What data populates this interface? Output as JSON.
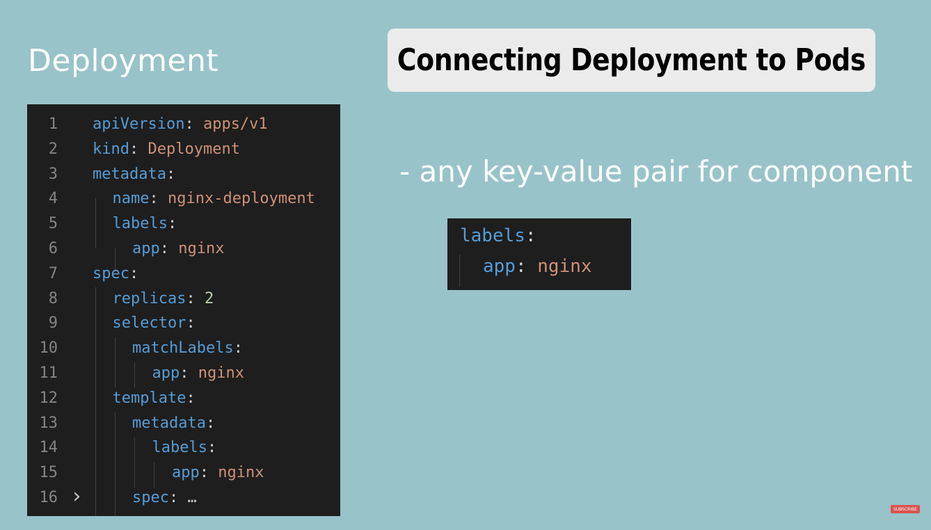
{
  "slide": {
    "section_title": "Deployment",
    "heading": "Connecting Deployment to Pods",
    "bullet": "- any key-value pair for component"
  },
  "editor": {
    "lines": [
      {
        "num": "1",
        "key": "apiVersion",
        "colon": ":",
        "value": "apps/v1",
        "type": "str"
      },
      {
        "num": "2",
        "key": "kind",
        "colon": ":",
        "value": "Deployment",
        "type": "str"
      },
      {
        "num": "3",
        "key": "metadata",
        "colon": ":",
        "value": "",
        "type": "str"
      },
      {
        "num": "4",
        "key": "name",
        "colon": ":",
        "value": "nginx-deployment",
        "type": "str"
      },
      {
        "num": "5",
        "key": "labels",
        "colon": ":",
        "value": "",
        "type": "str"
      },
      {
        "num": "6",
        "key": "app",
        "colon": ":",
        "value": "nginx",
        "type": "str"
      },
      {
        "num": "7",
        "key": "spec",
        "colon": ":",
        "value": "",
        "type": "str"
      },
      {
        "num": "8",
        "key": "replicas",
        "colon": ":",
        "value": "2",
        "type": "num"
      },
      {
        "num": "9",
        "key": "selector",
        "colon": ":",
        "value": "",
        "type": "str"
      },
      {
        "num": "10",
        "key": "matchLabels",
        "colon": ":",
        "value": "",
        "type": "str"
      },
      {
        "num": "11",
        "key": "app",
        "colon": ":",
        "value": "nginx",
        "type": "str"
      },
      {
        "num": "12",
        "key": "template",
        "colon": ":",
        "value": "",
        "type": "str"
      },
      {
        "num": "13",
        "key": "metadata",
        "colon": ":",
        "value": "",
        "type": "str"
      },
      {
        "num": "14",
        "key": "labels",
        "colon": ":",
        "value": "",
        "type": "str"
      },
      {
        "num": "15",
        "key": "app",
        "colon": ":",
        "value": "nginx",
        "type": "str"
      },
      {
        "num": "16",
        "key": "spec",
        "colon": ":",
        "value": "…",
        "type": "dots"
      }
    ],
    "fold_icon": "chevron-right-icon"
  },
  "snippet": {
    "line1_key": "labels",
    "line1_colon": ":",
    "line2_key": "app",
    "line2_colon": ":",
    "line2_value": "nginx"
  },
  "badge": {
    "label": "SUBSCRIBE"
  },
  "colors": {
    "background": "#98c3c9",
    "editor_bg": "#1e1e1e",
    "key": "#569cd6",
    "string": "#ce9178",
    "number": "#b5cea8"
  }
}
